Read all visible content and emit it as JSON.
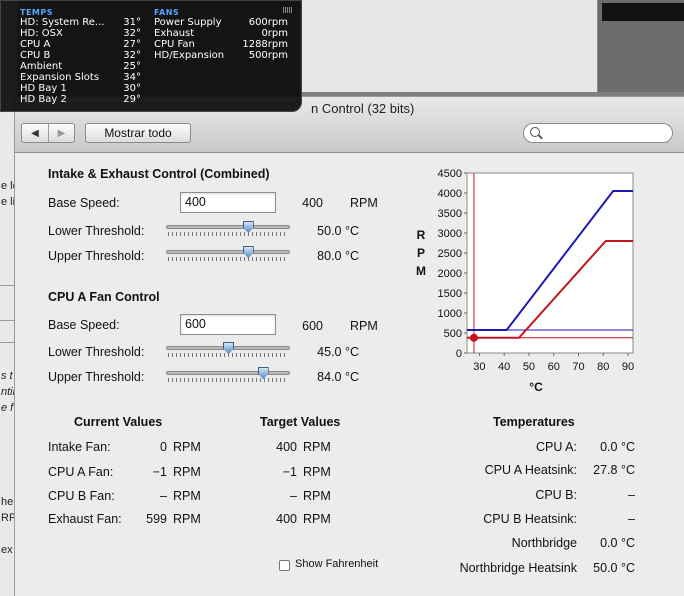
{
  "window": {
    "title": "n Control (32 bits)",
    "show_all_label": "Mostrar todo",
    "back_glyph": "◀",
    "forward_glyph": "▶"
  },
  "background": {
    "fragments": [
      "e lo",
      "e li",
      "s t",
      "ntir",
      "nte",
      "e f",
      "he",
      "RPI",
      "ex"
    ]
  },
  "hud": {
    "temps_header": "TEMPS",
    "fans_header": "FANS",
    "temps": [
      {
        "name": "HD: System Re...",
        "value": "31°"
      },
      {
        "name": "HD: OSX",
        "value": "32°"
      },
      {
        "name": "CPU A",
        "value": "27°"
      },
      {
        "name": "CPU B",
        "value": "32°"
      },
      {
        "name": "Ambient",
        "value": "25°"
      },
      {
        "name": "Expansion Slots",
        "value": "34°"
      },
      {
        "name": "HD Bay 1",
        "value": "30°"
      },
      {
        "name": "HD Bay 2",
        "value": "29°"
      }
    ],
    "fans": [
      {
        "name": "Power Supply",
        "value": "600rpm"
      },
      {
        "name": "Exhaust",
        "value": "0rpm"
      },
      {
        "name": "CPU Fan",
        "value": "1288rpm"
      },
      {
        "name": "HD/Expansion",
        "value": "500rpm"
      }
    ]
  },
  "intake": {
    "title": "Intake & Exhaust Control (Combined)",
    "base_speed_label": "Base Speed:",
    "base_speed_input": "400",
    "base_speed_value": "400",
    "rpm_unit": "RPM",
    "lower_label": "Lower Threshold:",
    "lower_value": "50.0 °C",
    "lower_fraction": 0.66,
    "upper_label": "Upper Threshold:",
    "upper_value": "80.0 °C",
    "upper_fraction": 0.66
  },
  "cpu_a": {
    "title": "CPU A Fan Control",
    "base_speed_label": "Base Speed:",
    "base_speed_input": "600",
    "base_speed_value": "600",
    "rpm_unit": "RPM",
    "lower_label": "Lower Threshold:",
    "lower_value": "45.0 °C",
    "lower_fraction": 0.5,
    "upper_label": "Upper Threshold:",
    "upper_value": "84.0 °C",
    "upper_fraction": 0.78
  },
  "current": {
    "header": "Current Values",
    "rows": [
      {
        "label": "Intake Fan:",
        "value": "0",
        "unit": "RPM"
      },
      {
        "label": "CPU A Fan:",
        "value": "−1",
        "unit": "RPM"
      },
      {
        "label": "CPU B Fan:",
        "value": "–",
        "unit": "RPM"
      },
      {
        "label": "Exhaust Fan:",
        "value": "599",
        "unit": "RPM"
      }
    ]
  },
  "target": {
    "header": "Target Values",
    "rows": [
      {
        "value": "400",
        "unit": "RPM"
      },
      {
        "value": "−1",
        "unit": "RPM"
      },
      {
        "value": "–",
        "unit": "RPM"
      },
      {
        "value": "400",
        "unit": "RPM"
      }
    ]
  },
  "temps": {
    "header": "Temperatures",
    "rows": [
      {
        "label": "CPU A:",
        "value": "0.0 °C"
      },
      {
        "label": "CPU A Heatsink:",
        "value": "27.8 °C"
      },
      {
        "label": "CPU B:",
        "value": "–"
      },
      {
        "label": "CPU B Heatsink:",
        "value": "–"
      },
      {
        "label": "Northbridge",
        "value": "0.0 °C"
      },
      {
        "label": "Northbridge Heatsink",
        "value": "50.0 °C"
      }
    ]
  },
  "fahrenheit_label": "Show Fahrenheit",
  "colors": {
    "blue_series": "#1f18b8",
    "red_series": "#c2151c"
  },
  "chart_data": {
    "type": "line",
    "xlabel": "°C",
    "ylabel": "RPM",
    "xlim": [
      25,
      92
    ],
    "ylim": [
      0,
      4500
    ],
    "x_ticks": [
      30,
      40,
      50,
      60,
      70,
      80,
      90
    ],
    "y_ticks": [
      0,
      500,
      1000,
      1500,
      2000,
      2500,
      3000,
      3500,
      4000,
      4500
    ],
    "series": [
      {
        "color": "#1f18b8",
        "x": [
          25,
          41,
          84,
          92
        ],
        "y": [
          575,
          575,
          4050,
          4050
        ]
      },
      {
        "color": "#c2151c",
        "x": [
          25,
          46,
          81,
          92
        ],
        "y": [
          380,
          380,
          2800,
          2800
        ]
      }
    ],
    "reference_lines": [
      {
        "axis": "y",
        "value": 575,
        "color": "#1f18b8"
      },
      {
        "axis": "y",
        "value": 380,
        "color": "#c2151c"
      },
      {
        "axis": "x",
        "value": 27.8,
        "color": "#c2151c"
      }
    ],
    "marker": {
      "x": 27.8,
      "y": 380,
      "color": "#c2151c"
    }
  }
}
